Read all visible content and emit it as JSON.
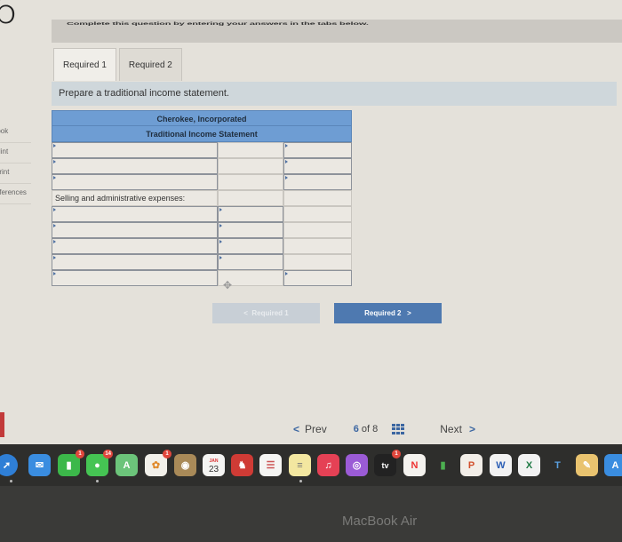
{
  "question": {
    "number": "6",
    "instruction": "Complete this question by entering your answers in the tabs below."
  },
  "side_links": [
    "Book",
    "Hint",
    "Print",
    "References"
  ],
  "tabs": [
    {
      "label": "Required 1",
      "active": true
    },
    {
      "label": "Required 2",
      "active": false
    }
  ],
  "prompt": "Prepare a traditional income statement.",
  "statement": {
    "company": "Cherokee, Incorporated",
    "title": "Traditional Income Statement",
    "rows": [
      {
        "label": "",
        "c2": "",
        "c3": ""
      },
      {
        "label": "",
        "c2": "",
        "c3": ""
      },
      {
        "label": "",
        "c2": "",
        "c3": ""
      },
      {
        "label": "Selling and administrative expenses:",
        "c2": "",
        "c3": ""
      },
      {
        "label": "",
        "c2": "",
        "c3": ""
      },
      {
        "label": "",
        "c2": "",
        "c3": ""
      },
      {
        "label": "",
        "c2": "",
        "c3": ""
      },
      {
        "label": "",
        "c2": "",
        "c3": ""
      },
      {
        "label": "",
        "c2": "",
        "c3": ""
      }
    ]
  },
  "nav_buttons": {
    "prev_label": "Required 1",
    "next_label": "Required 2"
  },
  "pager": {
    "prev": "Prev",
    "current": "6",
    "of_text": "of 8",
    "next": "Next"
  },
  "dock": {
    "calendar_month": "JAN",
    "calendar_day": "23",
    "facetime_badge": "1",
    "messages_badge": "14",
    "photos_badge": "1",
    "tv_label": "tv",
    "tv_badge": "1"
  },
  "laptop_label": "MacBook Air"
}
